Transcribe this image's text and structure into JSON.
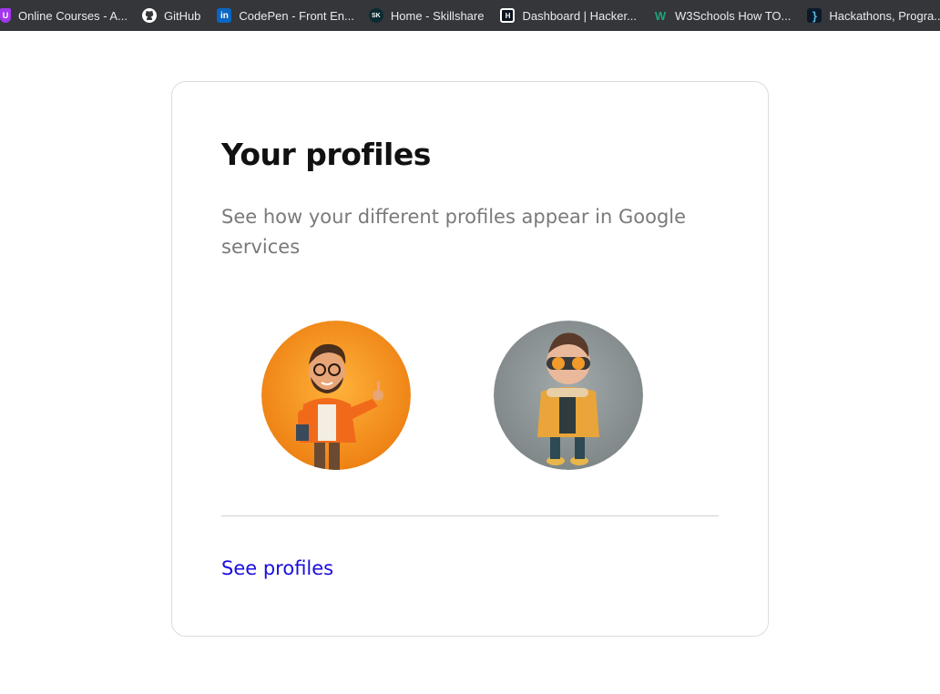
{
  "bookmarks": [
    {
      "label": "Online Courses - A...",
      "icon": "udemy-icon",
      "color": "#a435f0",
      "glyph": "U"
    },
    {
      "label": "GitHub",
      "icon": "github-icon",
      "color": "#35363a",
      "glyph": ""
    },
    {
      "label": "CodePen - Front En...",
      "icon": "linkedin-icon",
      "color": "#0a66c2",
      "glyph": "in"
    },
    {
      "label": "Home - Skillshare",
      "icon": "skillshare-icon",
      "color": "#0b2b33",
      "glyph": "SK"
    },
    {
      "label": "Dashboard | Hacker...",
      "icon": "hackerrank-icon",
      "color": "#0e141e",
      "glyph": "H"
    },
    {
      "label": "W3Schools How TO...",
      "icon": "w3schools-icon",
      "color": "#35363a",
      "glyph": "W"
    },
    {
      "label": "Hackathons, Progra...",
      "icon": "devpost-icon",
      "color": "#0b1a2a",
      "glyph": "}"
    }
  ],
  "card": {
    "title": "Your profiles",
    "description": "See how your different profiles appear in Google services",
    "link": "See profiles",
    "link_color": "#1a0dde"
  },
  "avatars": [
    {
      "name": "profile-avatar-orange",
      "bg": "#f28a17"
    },
    {
      "name": "profile-avatar-gray",
      "bg": "#8a9294"
    }
  ]
}
